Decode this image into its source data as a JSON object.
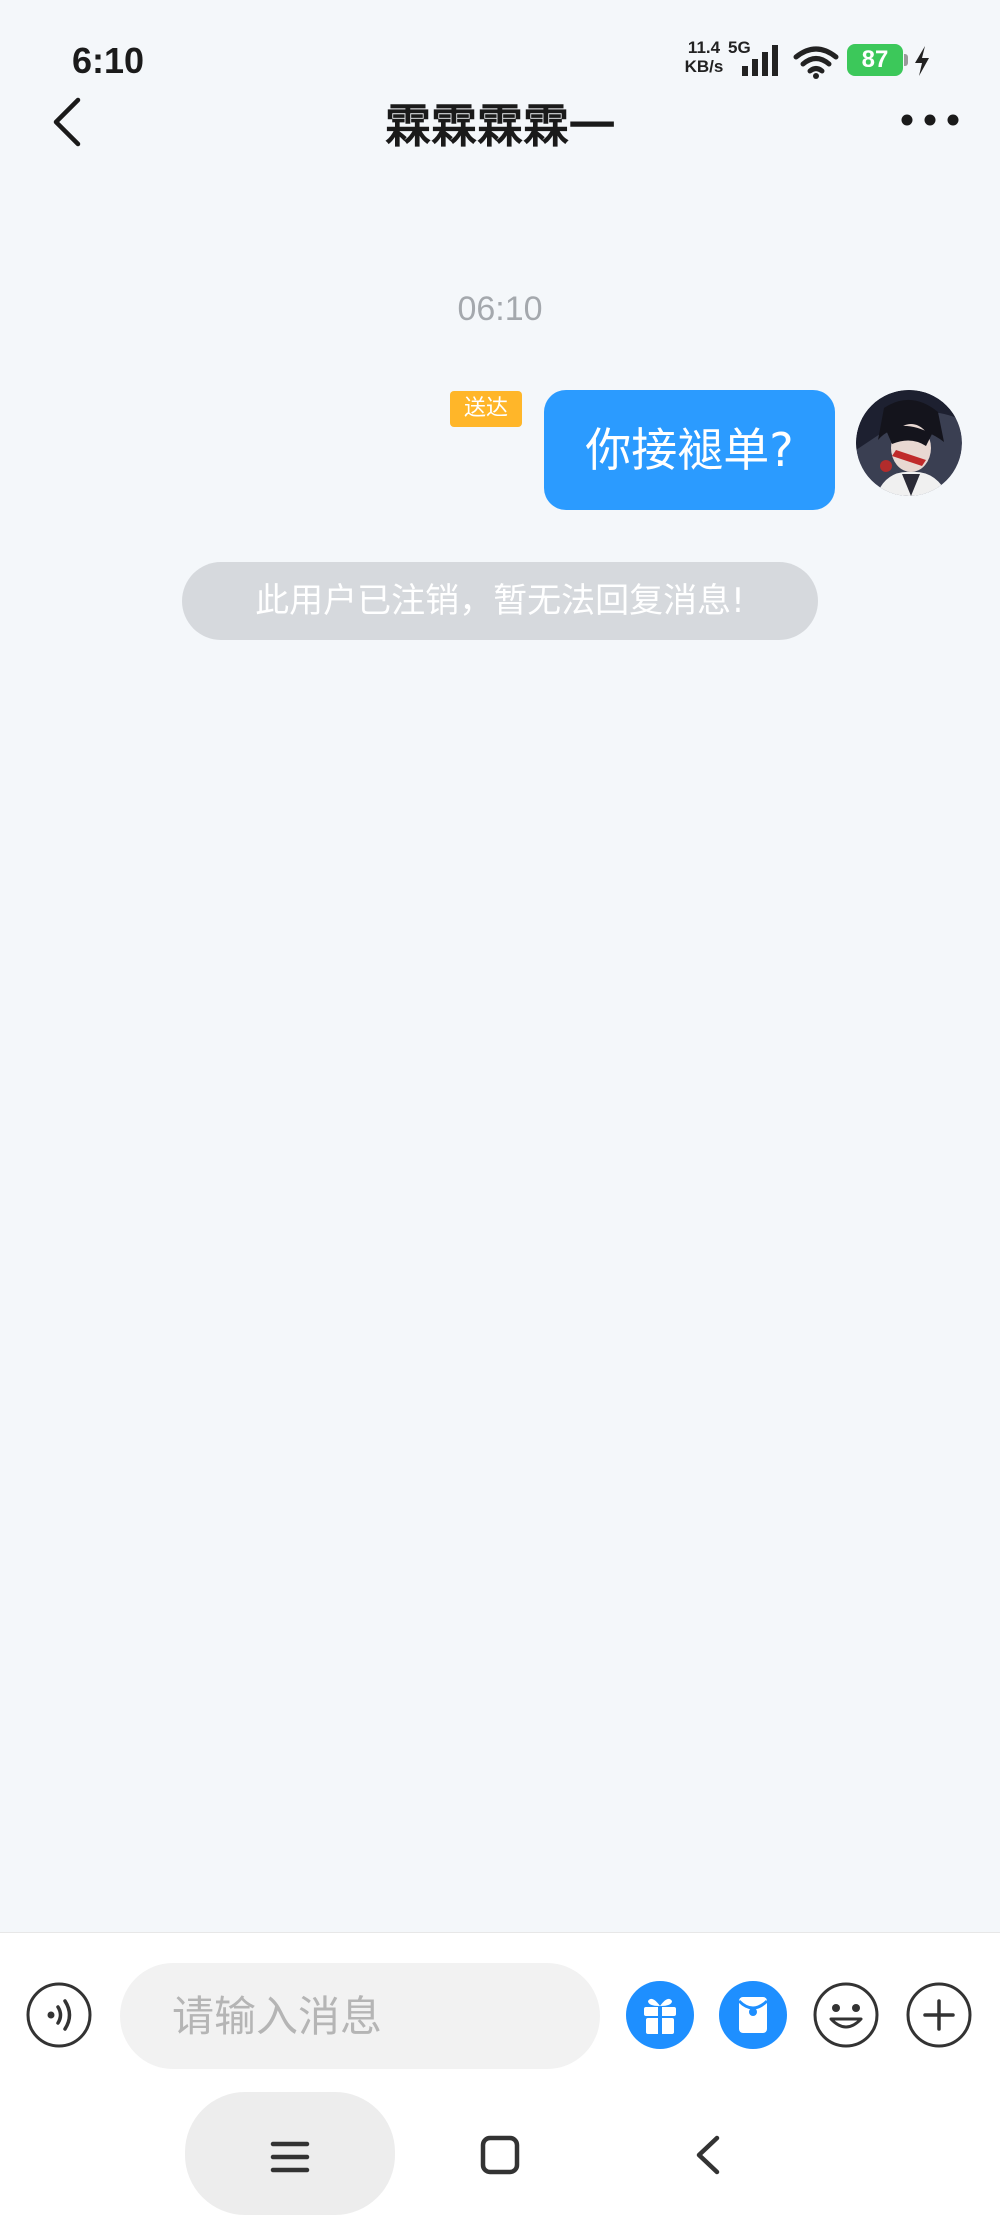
{
  "status_bar": {
    "time": "6:10",
    "net_speed_value": "11.4",
    "net_speed_unit": "KB/s",
    "network_type": "5G",
    "battery_percent": "87",
    "icons": [
      "signal-icon",
      "wifi-icon",
      "battery-icon",
      "charging-icon"
    ]
  },
  "header": {
    "title": "霖霖霖霖一",
    "back_icon": "chevron-left-icon",
    "more_icon": "more-dots-icon"
  },
  "chat": {
    "timestamp": "06:10",
    "messages": [
      {
        "sender": "me",
        "text": "你接褪单?",
        "status": "送达"
      }
    ],
    "system_notice": "此用户已注销，暂无法回复消息!"
  },
  "input_bar": {
    "placeholder": "请输入消息",
    "icons": [
      "voice-icon",
      "gift-icon",
      "red-packet-icon",
      "emoji-icon",
      "plus-icon"
    ]
  },
  "colors": {
    "background": "#f4f7fa",
    "bubble": "#2b9bff",
    "delivered_badge": "#ffb629",
    "battery": "#3cc85a",
    "notice": "#d6d9dd"
  },
  "nav_bar": {
    "icons": [
      "menu-icon",
      "home-square-icon",
      "back-icon"
    ]
  }
}
